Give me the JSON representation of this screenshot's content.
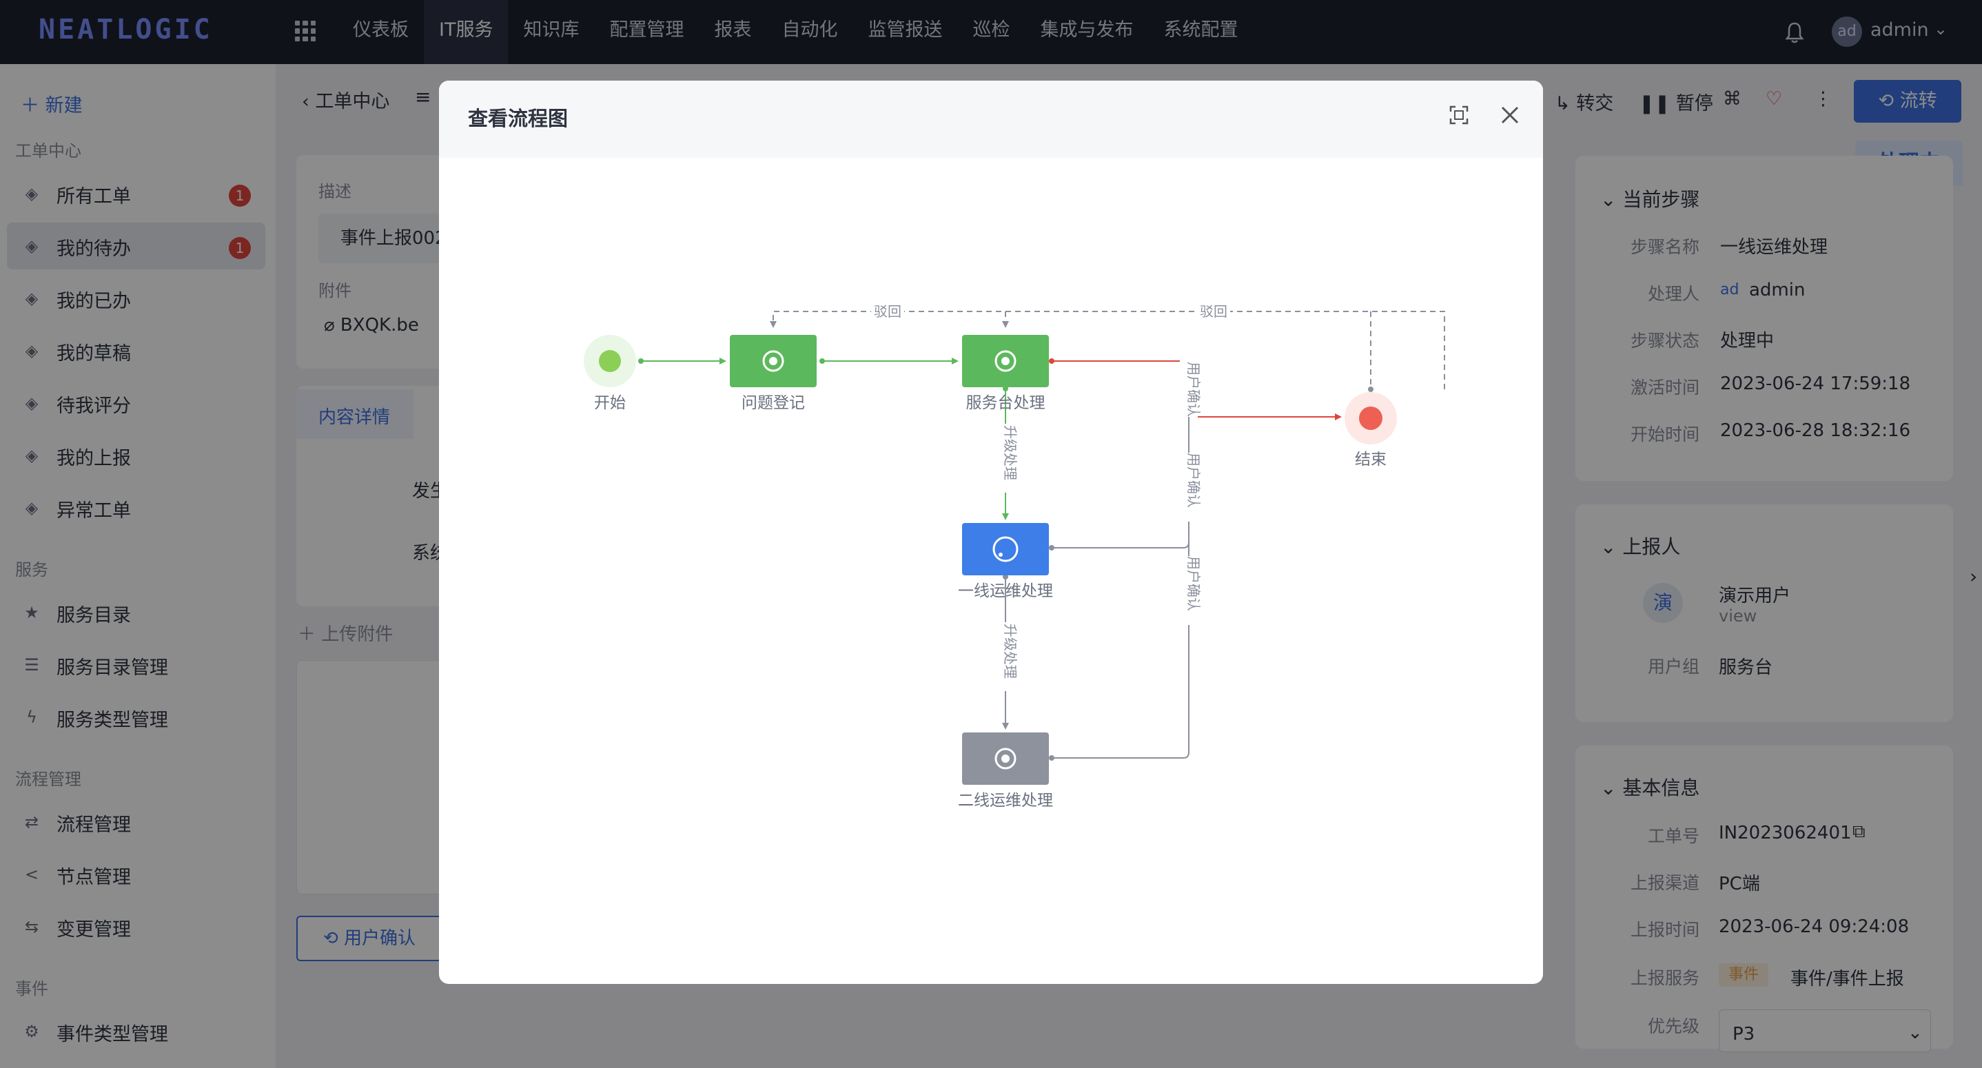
{
  "app": {
    "logo": "NEATLOGIC",
    "nav": [
      "仪表板",
      "IT服务",
      "知识库",
      "配置管理",
      "报表",
      "自动化",
      "监管报送",
      "巡检",
      "集成与发布",
      "系统配置"
    ],
    "active_nav": "IT服务",
    "avatar": "ad",
    "user": "admin"
  },
  "sidebar": {
    "new_label": "新建",
    "groups": [
      {
        "title": "工单中心",
        "items": [
          {
            "label": "所有工单",
            "badge": "1",
            "icon": "tag-icon"
          },
          {
            "label": "我的待办",
            "badge": "1",
            "icon": "tag-icon",
            "active": true
          },
          {
            "label": "我的已办",
            "icon": "tag-icon"
          },
          {
            "label": "我的草稿",
            "icon": "tag-icon"
          },
          {
            "label": "待我评分",
            "icon": "tag-icon"
          },
          {
            "label": "我的上报",
            "icon": "tag-icon"
          },
          {
            "label": "异常工单",
            "icon": "tag-icon"
          }
        ]
      },
      {
        "title": "服务",
        "items": [
          {
            "label": "服务目录",
            "icon": "star-icon"
          },
          {
            "label": "服务目录管理",
            "icon": "list-icon"
          },
          {
            "label": "服务类型管理",
            "icon": "bolt-icon"
          }
        ]
      },
      {
        "title": "流程管理",
        "items": [
          {
            "label": "流程管理",
            "icon": "flow-icon"
          },
          {
            "label": "节点管理",
            "icon": "share-icon"
          },
          {
            "label": "变更管理",
            "icon": "swap-icon"
          }
        ]
      },
      {
        "title": "事件",
        "items": [
          {
            "label": "事件类型管理",
            "icon": "gear-icon"
          }
        ]
      }
    ]
  },
  "content": {
    "breadcrumb": "工单中心",
    "desc_label": "描述",
    "desc_value": "事件上报002",
    "attach_label": "附件",
    "attach_file": "BXQK.be",
    "tab_label": "内容详情",
    "row_a": "发生",
    "row_b": "系统",
    "upload_label": "上传附件",
    "confirm_button": "用户确认"
  },
  "toolbar": {
    "transfer": "转交",
    "pause": "暂停",
    "flow_button": "流转",
    "status": "处理中"
  },
  "right_panel": {
    "current_step": {
      "title": "当前步骤",
      "rows": [
        {
          "label": "步骤名称",
          "value": "一线运维处理"
        },
        {
          "label": "处理人",
          "value": "admin",
          "avatar": "ad"
        },
        {
          "label": "步骤状态",
          "value": "处理中"
        },
        {
          "label": "激活时间",
          "value": "2023-06-24 17:59:18"
        },
        {
          "label": "开始时间",
          "value": "2023-06-28 18:32:16"
        }
      ]
    },
    "reporter": {
      "title": "上报人",
      "avatar": "演",
      "name": "演示用户",
      "account": "view",
      "group_label": "用户组",
      "group_value": "服务台"
    },
    "basic": {
      "title": "基本信息",
      "rows": [
        {
          "label": "工单号",
          "value": "IN2023062401"
        },
        {
          "label": "上报渠道",
          "value": "PC端"
        },
        {
          "label": "上报时间",
          "value": "2023-06-24 09:24:08"
        },
        {
          "label": "上报服务",
          "value": "事件/事件上报",
          "tag": "事件"
        },
        {
          "label": "优先级",
          "value": "P3"
        }
      ]
    }
  },
  "modal": {
    "title": "查看流程图",
    "nodes": {
      "start": "开始",
      "register": "问题登记",
      "service_desk": "服务台处理",
      "first_line": "一线运维处理",
      "second_line": "二线运维处理",
      "end": "结束"
    },
    "edges": {
      "reject": "驳回",
      "escalate": "升级处理",
      "user_confirm": "用户确认",
      "user_confirm_rotated": "用户确认"
    },
    "colors": {
      "done": "#5cb85c",
      "active": "#3d7ee8",
      "pending": "#8e929c",
      "end": "#ee6054",
      "edge_done": "#5cb85c",
      "edge_red": "#e0463c"
    }
  }
}
